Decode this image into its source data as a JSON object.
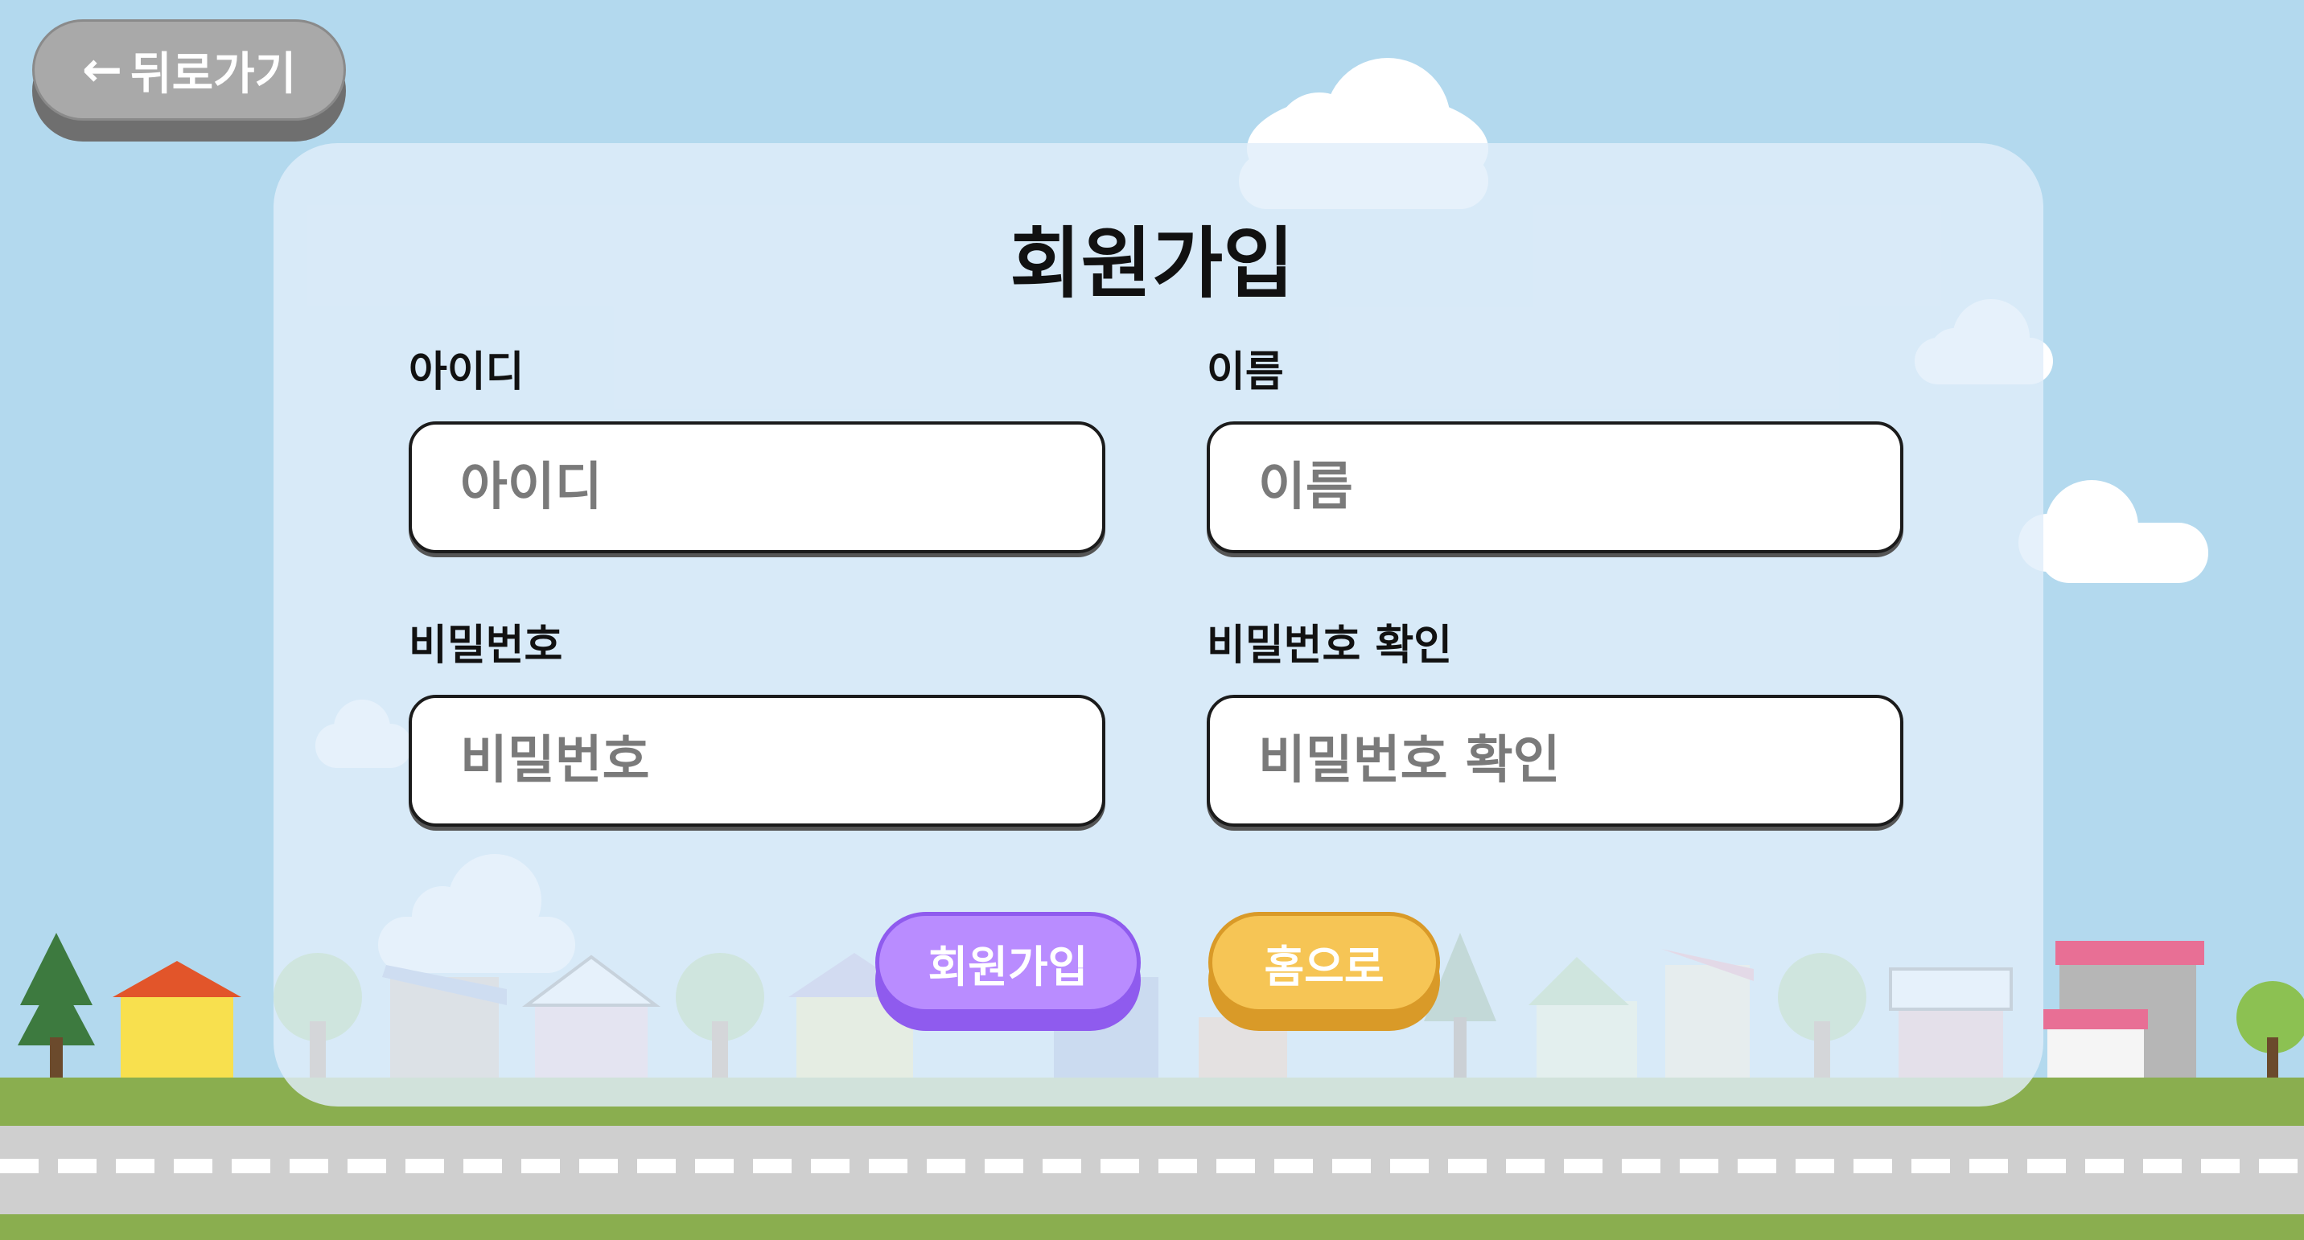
{
  "nav": {
    "back_label": "뒤로가기"
  },
  "form": {
    "title": "회원가입",
    "fields": [
      {
        "label": "아이디",
        "placeholder": "아이디"
      },
      {
        "label": "이름",
        "placeholder": "이름"
      },
      {
        "label": "비밀번호",
        "placeholder": "비밀번호"
      },
      {
        "label": "비밀번호 확인",
        "placeholder": "비밀번호 확인"
      }
    ],
    "signup_label": "회원가입",
    "home_label": "홈으로"
  },
  "colors": {
    "sky": "#b3d9ee",
    "signup_button": "#b98cff",
    "home_button": "#f6c555",
    "back_button": "#a9a9a9"
  }
}
